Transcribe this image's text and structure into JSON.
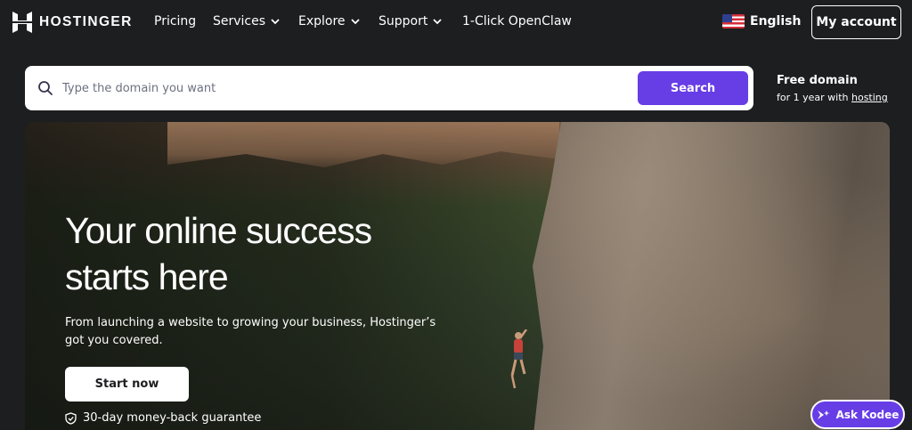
{
  "brand": {
    "name": "HOSTINGER",
    "accent": "#673de6",
    "background": "#1d1e20"
  },
  "nav": {
    "items": [
      {
        "label": "Pricing",
        "has_dropdown": false
      },
      {
        "label": "Services",
        "has_dropdown": true
      },
      {
        "label": "Explore",
        "has_dropdown": true
      },
      {
        "label": "Support",
        "has_dropdown": true
      },
      {
        "label": "1-Click OpenClaw",
        "has_dropdown": false
      }
    ],
    "language": {
      "label": "English",
      "icon": "us-flag-icon"
    },
    "account_label": "My account"
  },
  "search": {
    "placeholder": "Type the domain you want",
    "value": "",
    "button_label": "Search",
    "icon": "search-icon"
  },
  "free_domain": {
    "title": "Free domain",
    "subtitle_prefix": "for 1 year with ",
    "link_label": "hosting"
  },
  "hero": {
    "title_line1": "Your online success",
    "title_line2": "starts here",
    "subtitle": "From launching a website to growing your business, Hostinger’s got you covered.",
    "cta_label": "Start now",
    "guarantee_label": "30-day money-back guarantee",
    "guarantee_icon": "shield-check-icon"
  },
  "assistant": {
    "label": "Ask Kodee",
    "icon": "kodee-sparkle-icon"
  }
}
